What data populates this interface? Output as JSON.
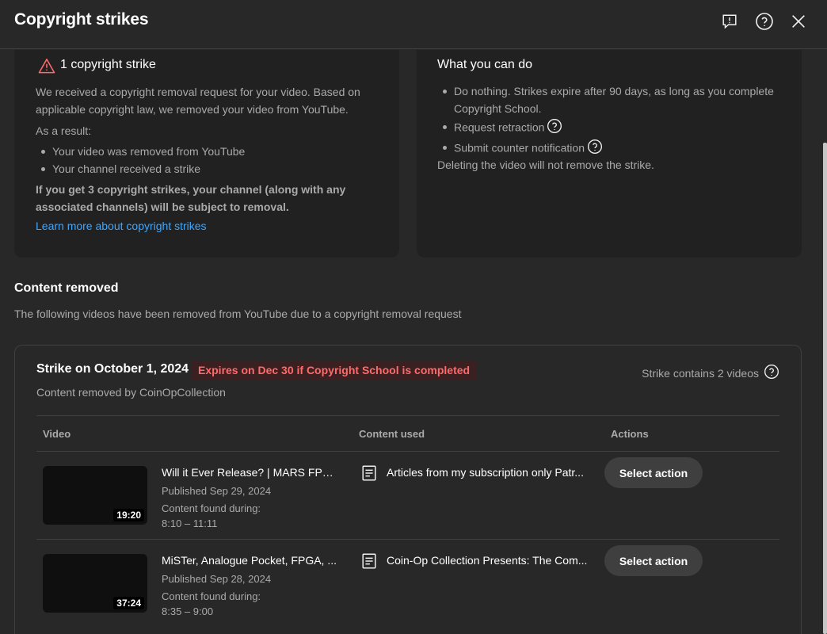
{
  "header": {
    "title": "Copyright strikes"
  },
  "strike_summary": {
    "count_label": "1 copyright strike",
    "p1": "We received a copyright removal request for your video. Based on applicable copyright law, we removed your video from YouTube.",
    "p2": "As a result:",
    "bullets": [
      "Your video was removed from YouTube",
      "Your channel received a strike"
    ],
    "warning": "If you get 3 copyright strikes, your channel (along with any associated channels) will be subject to removal.",
    "learn_more": "Learn more about copyright strikes"
  },
  "what_you_can_do": {
    "title": "What you can do",
    "items": [
      "Do nothing. Strikes expire after 90 days, as long as you complete Copyright School.",
      "Request retraction",
      "Submit counter notification"
    ],
    "note": "Deleting the video will not remove the strike."
  },
  "content_removed": {
    "title": "Content removed",
    "subtitle": "The following videos have been removed from YouTube due to a copyright removal request"
  },
  "strike": {
    "title": "Strike on October 1, 2024",
    "expires": "Expires on Dec 30 if Copyright School is completed",
    "removed_by": "Content removed by CoinOpCollection",
    "contains": "Strike contains 2 videos",
    "columns": [
      "Video",
      "Content used",
      "Actions"
    ],
    "rows": [
      {
        "title": "Will it Ever Release? | MARS FPGA",
        "published": "Published Sep 29, 2024",
        "found_label": "Content found during:",
        "range": "8:10 – 11:11",
        "duration": "19:20",
        "content_used": "Articles from my subscription only Patr...",
        "action": "Select action"
      },
      {
        "title": "MiSTer, Analogue Pocket, FPGA, ...",
        "published": "Published Sep 28, 2024",
        "found_label": "Content found during:",
        "range": "8:35 – 9:00",
        "duration": "37:24",
        "content_used": "Coin-Op Collection Presents: The Com...",
        "action": "Select action"
      }
    ]
  },
  "colors": {
    "background": "#282828",
    "card": "#212121",
    "link": "#3ea6ff",
    "badge_text": "#ff6b6b",
    "badge_bg": "#3a2020"
  },
  "icons": [
    "feedback-icon",
    "help-icon",
    "close-icon",
    "warning-icon",
    "question-icon",
    "document-icon"
  ]
}
